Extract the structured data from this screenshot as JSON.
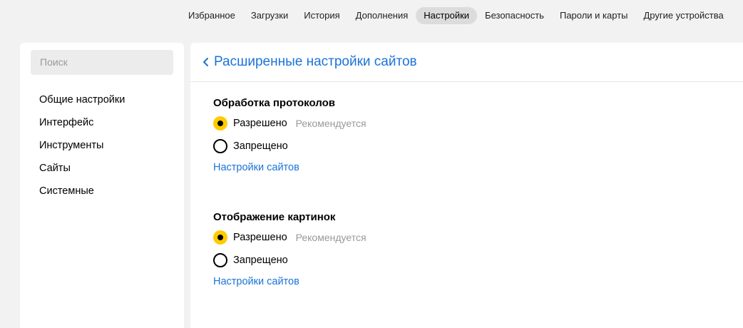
{
  "nav": {
    "items": [
      {
        "label": "Избранное",
        "active": false
      },
      {
        "label": "Загрузки",
        "active": false
      },
      {
        "label": "История",
        "active": false
      },
      {
        "label": "Дополнения",
        "active": false
      },
      {
        "label": "Настройки",
        "active": true
      },
      {
        "label": "Безопасность",
        "active": false
      },
      {
        "label": "Пароли и карты",
        "active": false
      },
      {
        "label": "Другие устройства",
        "active": false
      }
    ]
  },
  "sidebar": {
    "search_placeholder": "Поиск",
    "items": [
      {
        "label": "Общие настройки"
      },
      {
        "label": "Интерфейс"
      },
      {
        "label": "Инструменты"
      },
      {
        "label": "Сайты"
      },
      {
        "label": "Системные"
      }
    ]
  },
  "page": {
    "title": "Расширенные настройки сайтов",
    "back_icon": "chevron-left-icon"
  },
  "sections": [
    {
      "title": "Обработка протоколов",
      "options": [
        {
          "label": "Разрешено",
          "hint": "Рекомендуется",
          "checked": true
        },
        {
          "label": "Запрещено",
          "hint": "",
          "checked": false
        }
      ],
      "link": "Настройки сайтов"
    },
    {
      "title": "Отображение картинок",
      "options": [
        {
          "label": "Разрешено",
          "hint": "Рекомендуется",
          "checked": true
        },
        {
          "label": "Запрещено",
          "hint": "",
          "checked": false
        }
      ],
      "link": "Настройки сайтов"
    }
  ],
  "colors": {
    "accent_link": "#1a73d9",
    "radio_selected": "#ffcc00",
    "active_tab_bg": "#dcdcdc",
    "page_bg": "#f2f2f2"
  }
}
